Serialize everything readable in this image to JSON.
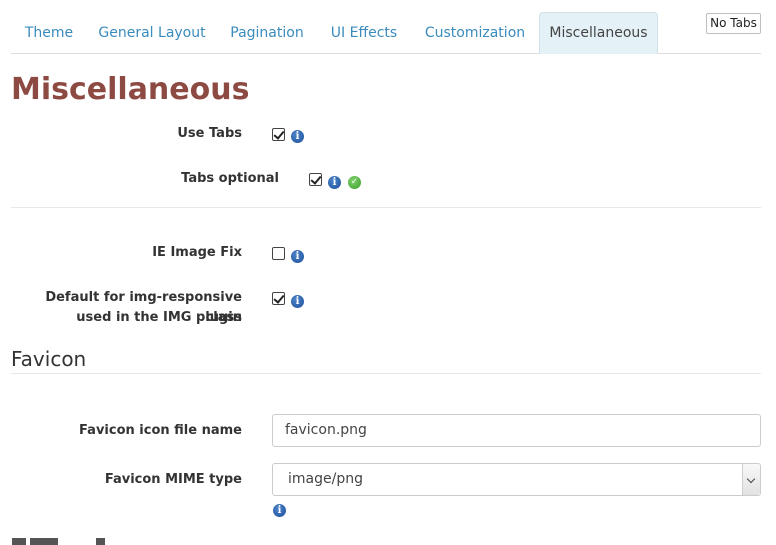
{
  "tabs": [
    {
      "label": "Theme",
      "active": false
    },
    {
      "label": "General Layout",
      "active": false
    },
    {
      "label": "Pagination",
      "active": false
    },
    {
      "label": "UI Effects",
      "active": false
    },
    {
      "label": "Customization",
      "active": false
    },
    {
      "label": "Miscellaneous",
      "active": true
    }
  ],
  "no_tabs_button": "No Tabs",
  "page_title": "Miscellaneous",
  "settings": {
    "use_tabs": {
      "label": "Use Tabs",
      "checked": true
    },
    "tabs_optional": {
      "label": "Tabs optional",
      "checked": true
    },
    "ie_image_fix": {
      "label": "IE Image Fix",
      "checked": false
    },
    "img_responsive": {
      "label_line1": "Default for img-responsive class",
      "label_line2": "used in the IMG plugin",
      "checked": true
    }
  },
  "favicon": {
    "section_title": "Favicon",
    "file_name_label": "Favicon icon file name",
    "file_name_value": "favicon.png",
    "mime_label": "Favicon MIME type",
    "mime_value": "image/png"
  },
  "icons": {
    "info": "info-icon",
    "ok": "checkmark-icon"
  },
  "colors": {
    "accent": "#3a8bbd",
    "title": "#8d4a42",
    "active_tab_bg": "#e4f1f6"
  }
}
